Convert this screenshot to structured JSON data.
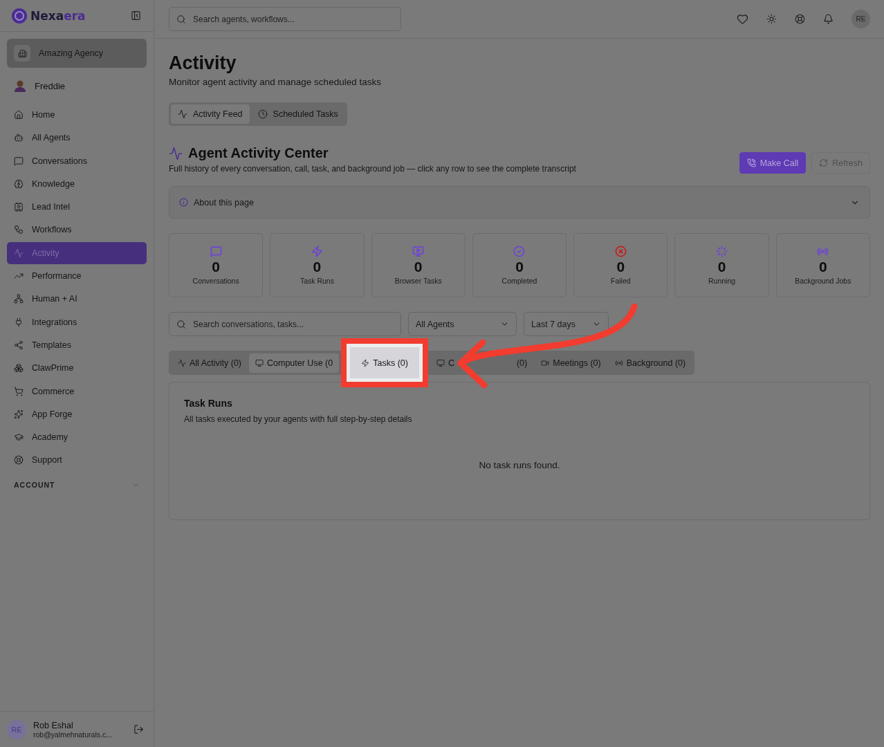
{
  "brand": {
    "name_start": "Nexa",
    "name_end": "era"
  },
  "workspace": {
    "name": "Amazing Agency"
  },
  "profile": {
    "name": "Freddie"
  },
  "nav": [
    {
      "label": "Home",
      "selected": false
    },
    {
      "label": "All Agents",
      "selected": false
    },
    {
      "label": "Conversations",
      "selected": false
    },
    {
      "label": "Knowledge",
      "selected": false
    },
    {
      "label": "Lead Intel",
      "selected": false
    },
    {
      "label": "Workflows",
      "selected": false
    },
    {
      "label": "Activity",
      "selected": true
    },
    {
      "label": "Performance",
      "selected": false
    },
    {
      "label": "Human + AI",
      "selected": false
    },
    {
      "label": "Integrations",
      "selected": false
    },
    {
      "label": "Templates",
      "selected": false
    },
    {
      "label": "ClawPrime",
      "selected": false
    },
    {
      "label": "Commerce",
      "selected": false
    },
    {
      "label": "App Forge",
      "selected": false
    },
    {
      "label": "Academy",
      "selected": false
    },
    {
      "label": "Support",
      "selected": false
    }
  ],
  "account_section": {
    "label": "ACCOUNT"
  },
  "user": {
    "initials": "RE",
    "name": "Rob Eshal",
    "email": "rob@yalmehnaturals.c..."
  },
  "topbar": {
    "search_placeholder": "Search agents, workflows...",
    "avatar": "RE"
  },
  "page": {
    "title": "Activity",
    "subtitle": "Monitor agent activity and manage scheduled tasks"
  },
  "view_tabs": [
    {
      "label": "Activity Feed",
      "selected": true
    },
    {
      "label": "Scheduled Tasks",
      "selected": false
    }
  ],
  "section": {
    "title": "Agent Activity Center",
    "description": "Full history of every conversation, call, task, and background job — click any row to see the complete transcript"
  },
  "actions": [
    {
      "label": "Make Call",
      "kind": "primary"
    },
    {
      "label": "Refresh",
      "kind": "ghost"
    }
  ],
  "about": {
    "label": "About this page",
    "expanded": false
  },
  "stats": [
    {
      "value": "0",
      "label": "Conversations",
      "color": "#6d45d6"
    },
    {
      "value": "0",
      "label": "Task Runs",
      "color": "#6d45d6"
    },
    {
      "value": "0",
      "label": "Browser Tasks",
      "color": "#6d45d6"
    },
    {
      "value": "0",
      "label": "Completed",
      "color": "#6d45d6"
    },
    {
      "value": "0",
      "label": "Failed",
      "color": "#c81e1e"
    },
    {
      "value": "0",
      "label": "Running",
      "color": "#6d45d6"
    },
    {
      "value": "0",
      "label": "Background Jobs",
      "color": "#6d45d6"
    }
  ],
  "filters": {
    "search_placeholder": "Search conversations, tasks...",
    "agent": "All Agents",
    "range": "Last 7 days"
  },
  "activity_tabs": [
    {
      "label": "All Activity (0)",
      "selected": false,
      "highlighted": false
    },
    {
      "label": "Computer Use (0",
      "selected": true,
      "highlighted": false
    },
    {
      "label": "Tasks (0)",
      "selected": false,
      "highlighted": true
    },
    {
      "label": "C",
      "count": "(0)",
      "selected": false,
      "highlighted": false
    },
    {
      "label": "Meetings (0)",
      "selected": false,
      "highlighted": false
    },
    {
      "label": "Background (0)",
      "selected": false,
      "highlighted": false
    }
  ],
  "panel": {
    "title": "Task Runs",
    "description": "All tasks executed by your agents with full step-by-step details",
    "empty": "No task runs found."
  }
}
